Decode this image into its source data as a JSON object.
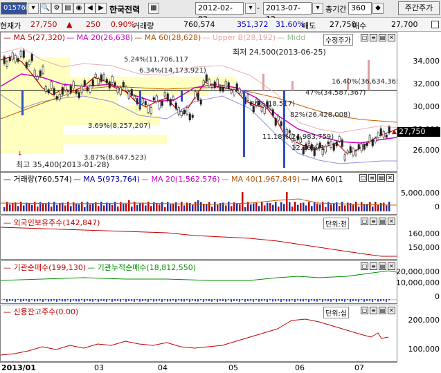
{
  "toolbar": {
    "code": "015760",
    "name": "한국전력",
    "start_date": "2012-02-02",
    "end_date": "2013-07-12",
    "period_label": "총기간",
    "period_value": "360",
    "mode_button": "주간주가"
  },
  "infobar": {
    "price_label": "현재가",
    "price": "27,750",
    "change": "250",
    "change_pct": "0.90%",
    "volume_label": "거래량",
    "volume": "760,574",
    "ask_volume": "351,372",
    "ask_pct": "31.60%",
    "ask_label": "매도",
    "ask_price": "27,750",
    "bid_label": "매수",
    "bid_price": "27,700"
  },
  "price_panel": {
    "legend": [
      {
        "text": "MA 5(27,320)",
        "color": "#c00000"
      },
      {
        "text": "MA 20(26,638)",
        "color": "#cc00cc"
      },
      {
        "text": "MA 60(28,628)",
        "color": "#b05000"
      },
      {
        "text": "Upper B(28,192)",
        "color": "#e8a0a0"
      },
      {
        "text": "Midd",
        "color": "#90c090"
      }
    ],
    "tag": "수정주가",
    "min_note": "최저 24,500(2013-06-25)",
    "max_note": "최고 35,400(2013-01-28)",
    "current_price_tag": "27,750",
    "fib_labels": [
      {
        "text": "5.24%(11,706,117"
      },
      {
        "text": "6.34%(14,173,921)"
      },
      {
        "text": "16.40%(36,634,365)"
      },
      {
        "text": "47%(34,587,367)"
      },
      {
        "text": "86%(18,517)"
      },
      {
        "text": "82%(26,428,008)"
      },
      {
        "text": "3.69%(8,257,207)"
      },
      {
        "text": "11.18%(24,983,759)"
      },
      {
        "text": "12.20%(1"
      },
      {
        "text": "3.87%(8,647,523)"
      }
    ],
    "y_ticks": [
      "34,000",
      "32,000",
      "30,000",
      "28,000",
      "26,000"
    ]
  },
  "volume_panel": {
    "legend": [
      {
        "text": "거래량(760,574)",
        "color": "#000000"
      },
      {
        "text": "MA 5(973,764)",
        "color": "#0000aa"
      },
      {
        "text": "MA 20(1,562,576)",
        "color": "#cc00cc"
      },
      {
        "text": "MA 40(1,967,849)",
        "color": "#b05000"
      },
      {
        "text": "MA 60(1",
        "color": "#000000"
      }
    ],
    "y_ticks": [
      "5,000,000",
      "0"
    ]
  },
  "foreign_panel": {
    "legend": [
      {
        "text": "외국인보유주수(142,847)",
        "color": "#c00000"
      }
    ],
    "unit": "단위:천",
    "y_ticks": [
      "160,000",
      "150,000"
    ]
  },
  "inst_panel": {
    "legend": [
      {
        "text": "기관순매수(199,130)",
        "color": "#c00000"
      },
      {
        "text": "기관누적순매수(18,812,550)",
        "color": "#009000"
      }
    ],
    "y_ticks": [
      "20,000,000",
      "10,000,000",
      "0"
    ]
  },
  "credit_panel": {
    "legend": [
      {
        "text": "신용잔고주수(0.00)",
        "color": "#c00000"
      }
    ],
    "unit": "단위:십",
    "y_ticks": [
      "200,000",
      "100,000"
    ]
  },
  "x_labels": [
    "2013/01",
    "03",
    "04",
    "05",
    "06",
    "07"
  ],
  "panel_controls": [
    "▢",
    "≡",
    "▤",
    "✕"
  ]
}
